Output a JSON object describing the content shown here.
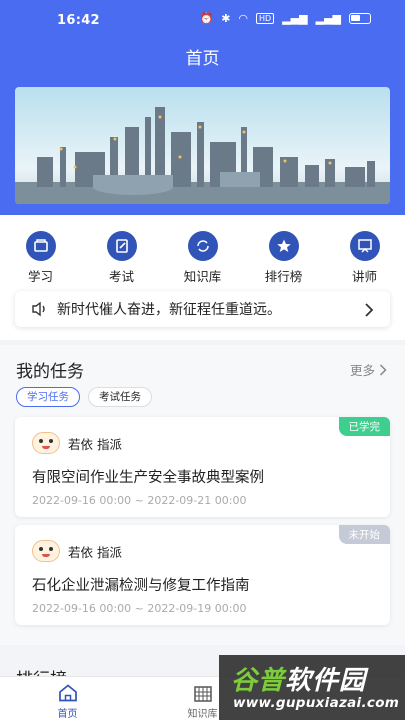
{
  "status_bar": {
    "time": "16:42",
    "net_label": "HD"
  },
  "header": {
    "title": "首页"
  },
  "nav": [
    {
      "label": "学习",
      "icon": "book-icon"
    },
    {
      "label": "考试",
      "icon": "exam-icon"
    },
    {
      "label": "知识库",
      "icon": "knowledge-icon"
    },
    {
      "label": "排行榜",
      "icon": "star-icon"
    },
    {
      "label": "讲师",
      "icon": "lecturer-icon"
    }
  ],
  "notice": {
    "text": "新时代催人奋进，新征程任重道远。"
  },
  "tasks": {
    "title": "我的任务",
    "more": "更多",
    "tabs": [
      "学习任务",
      "考试任务"
    ],
    "items": [
      {
        "assigner": "若依",
        "action": "指派",
        "title": "有限空间作业生产安全事故典型案例",
        "date": "2022-09-16 00:00 ~ 2022-09-21 00:00",
        "status": "已学完",
        "status_color": "#3ecf8e"
      },
      {
        "assigner": "若依",
        "action": "指派",
        "title": "石化企业泄漏检测与修复工作指南",
        "date": "2022-09-16 00:00 ~ 2022-09-19 00:00",
        "status": "未开始",
        "status_color": "#c4cad6"
      }
    ]
  },
  "ranking": {
    "title": "排行榜"
  },
  "tabbar": [
    {
      "label": "首页",
      "icon": "home-icon"
    },
    {
      "label": "知识库",
      "icon": "building-icon"
    },
    {
      "label": "",
      "icon": ""
    }
  ],
  "watermark": {
    "main_a": "谷普",
    "main_b": "软件园",
    "url": "www.gupuxiazai.com"
  },
  "colors": {
    "brand": "#4a6cf0",
    "nav_icon": "#3054b8"
  }
}
